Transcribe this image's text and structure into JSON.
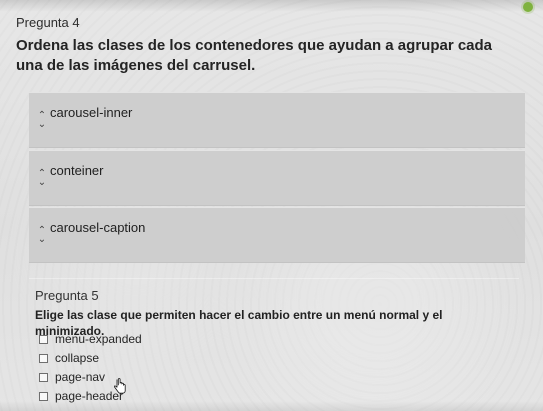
{
  "question4": {
    "label": "Pregunta 4",
    "text": "Ordena las clases de los contenedores que ayudan a agrupar cada una de las imágenes del carrusel.",
    "items": [
      {
        "label": "carousel-inner"
      },
      {
        "label": "conteiner"
      },
      {
        "label": "carousel-caption"
      }
    ]
  },
  "question5": {
    "label": "Pregunta 5",
    "text": "Elige las clase que permiten hacer el cambio entre un menú normal y el minimizado.",
    "options": [
      {
        "label": "menu-expanded"
      },
      {
        "label": "collapse"
      },
      {
        "label": "page-nav"
      },
      {
        "label": "page-header"
      }
    ]
  },
  "icons": {
    "sort_handle": "chevron-up-down-icon",
    "checkbox": "checkbox-icon",
    "cursor": "hand-cursor-icon"
  },
  "colors": {
    "background": "#e2e2e2",
    "panel": "#cccccc",
    "text": "#222222",
    "accent_dot": "#7fb23e"
  }
}
